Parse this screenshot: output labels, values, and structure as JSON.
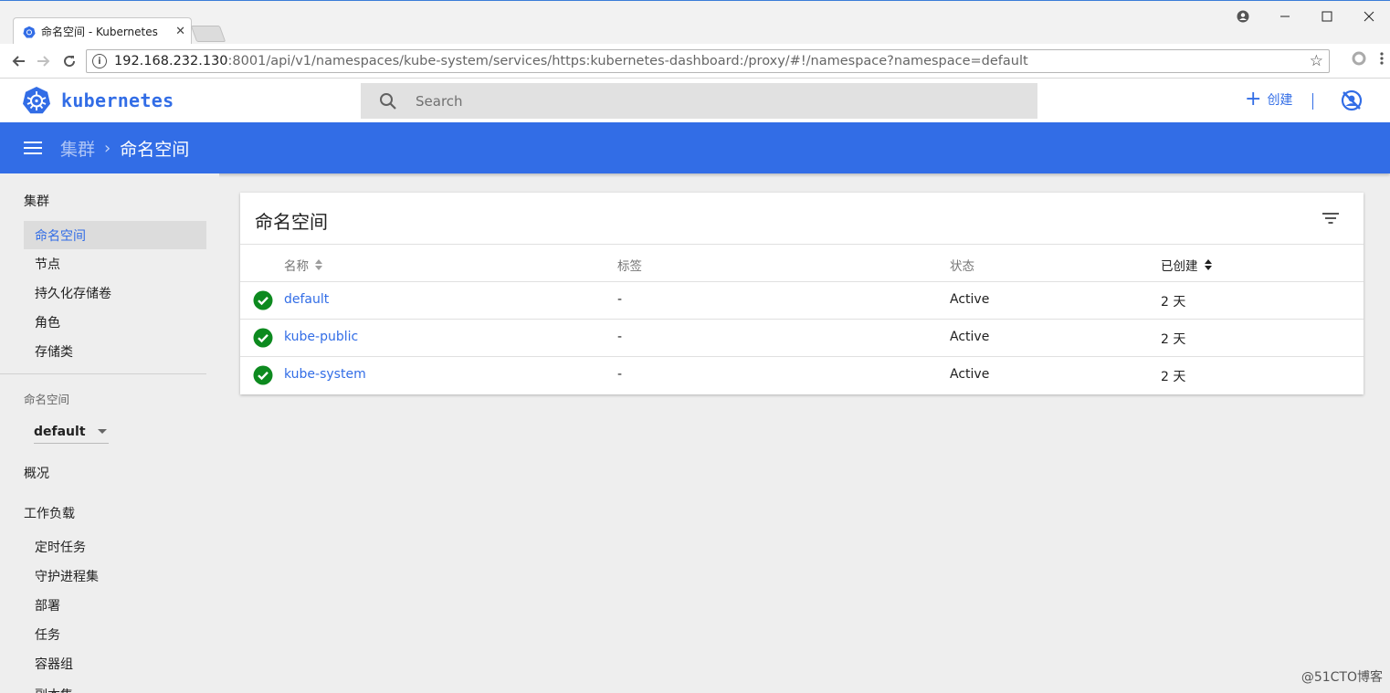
{
  "browser": {
    "tab_title": "命名空间 - Kubernetes",
    "tab_close": "✕",
    "url_host": "192.168.232.130",
    "url_path": ":8001/api/v1/namespaces/kube-system/services/https:kubernetes-dashboard:/proxy/#!/namespace?namespace=default",
    "window_controls": [
      "person-icon",
      "minimize-icon",
      "maximize-icon",
      "close-icon"
    ]
  },
  "header": {
    "brand": "kubernetes",
    "search_placeholder": "Search",
    "create_label": "创建",
    "brand_color": "#326de6"
  },
  "toolbar": {
    "breadcrumb_parent": "集群",
    "breadcrumb_separator": "›",
    "breadcrumb_current": "命名空间"
  },
  "sidebar": {
    "cluster_heading": "集群",
    "cluster_items": [
      {
        "label": "命名空间",
        "active": true
      },
      {
        "label": "节点"
      },
      {
        "label": "持久化存储卷"
      },
      {
        "label": "角色"
      },
      {
        "label": "存储类"
      }
    ],
    "namespace_label": "命名空间",
    "namespace_selected": "default",
    "overview": "概况",
    "workloads_heading": "工作负载",
    "workload_items": [
      {
        "label": "定时任务"
      },
      {
        "label": "守护进程集"
      },
      {
        "label": "部署"
      },
      {
        "label": "任务"
      },
      {
        "label": "容器组"
      },
      {
        "label": "副本集"
      }
    ]
  },
  "card": {
    "title": "命名空间",
    "columns": [
      "名称",
      "标签",
      "状态",
      "已创建"
    ],
    "rows": [
      {
        "name": "default",
        "labels": "-",
        "status": "Active",
        "created": "2 天"
      },
      {
        "name": "kube-public",
        "labels": "-",
        "status": "Active",
        "created": "2 天"
      },
      {
        "name": "kube-system",
        "labels": "-",
        "status": "Active",
        "created": "2 天"
      }
    ],
    "status_ok_color": "#0d8a1f"
  },
  "watermark": "@51CTO博客"
}
